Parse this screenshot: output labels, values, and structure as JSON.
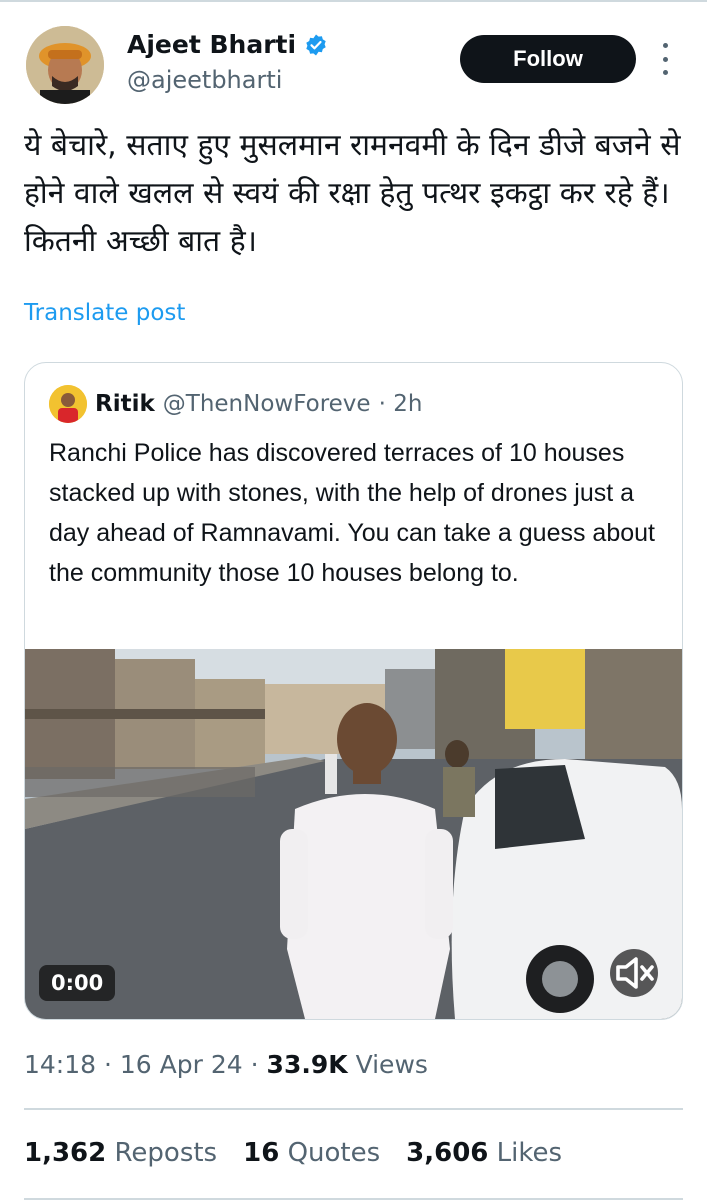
{
  "author": {
    "name": "Ajeet Bharti",
    "handle": "@ajeetbharti",
    "verified": true,
    "follow_label": "Follow"
  },
  "post": {
    "text": "ये बेचारे, सताए हुए मुसलमान रामनवमी के दिन डीजे बजने से होने वाले खलल से स्वयं की रक्षा हेतु पत्थर इकट्ठा कर रहे हैं। कितनी अच्छी बात है।",
    "translate_label": "Translate post"
  },
  "quoted": {
    "name": "Ritik",
    "handle": "@ThenNowForeve",
    "time": "· 2h",
    "text": "Ranchi Police has discovered terraces of 10 houses stacked up with stones, with the help of drones just a day ahead of Ramnavami. You can take a guess about the community those 10 houses belong to.",
    "video_time": "0:00"
  },
  "meta": {
    "time": "14:18",
    "date": "16 Apr 24",
    "views_count": "33.9K",
    "views_label": "Views",
    "sep": "·"
  },
  "stats": {
    "reposts_count": "1,362",
    "reposts_label": "Reposts",
    "quotes_count": "16",
    "quotes_label": "Quotes",
    "likes_count": "3,606",
    "likes_label": "Likes"
  },
  "colors": {
    "accent": "#1d9bf0",
    "text": "#0f1419",
    "muted": "#536471",
    "border": "#cfd9de"
  }
}
